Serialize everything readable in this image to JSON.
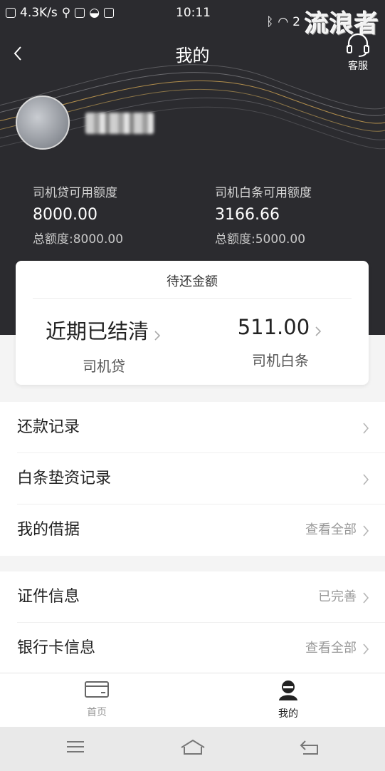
{
  "status_bar": {
    "speed": "4.3K/s",
    "time": "10:11",
    "battery_partial": "2",
    "watermark": "流浪者"
  },
  "header": {
    "title": "我的",
    "service_label": "客服"
  },
  "credit": {
    "driver_loan": {
      "label": "司机贷可用额度",
      "amount": "8000.00",
      "total": "总额度:8000.00"
    },
    "driver_ious": {
      "label": "司机白条可用额度",
      "amount": "3166.66",
      "total": "总额度:5000.00"
    }
  },
  "repay_card": {
    "title": "待还金额",
    "left": {
      "value": "近期已结清",
      "label": "司机贷"
    },
    "right": {
      "value": "511.00",
      "label": "司机白条"
    }
  },
  "menu_group1": [
    {
      "label": "还款记录",
      "value": ""
    },
    {
      "label": "白条垫资记录",
      "value": ""
    },
    {
      "label": "我的借据",
      "value": "查看全部"
    }
  ],
  "menu_group2": [
    {
      "label": "证件信息",
      "value": "已完善"
    },
    {
      "label": "银行卡信息",
      "value": "查看全部"
    }
  ],
  "tabbar": {
    "home_label": "首页",
    "mine_label": "我的"
  },
  "colors": {
    "hero_bg": "#2b2b2f",
    "accent_gold": "#b08d4c",
    "tab_active": "#222222",
    "tab_inactive": "#999999"
  }
}
